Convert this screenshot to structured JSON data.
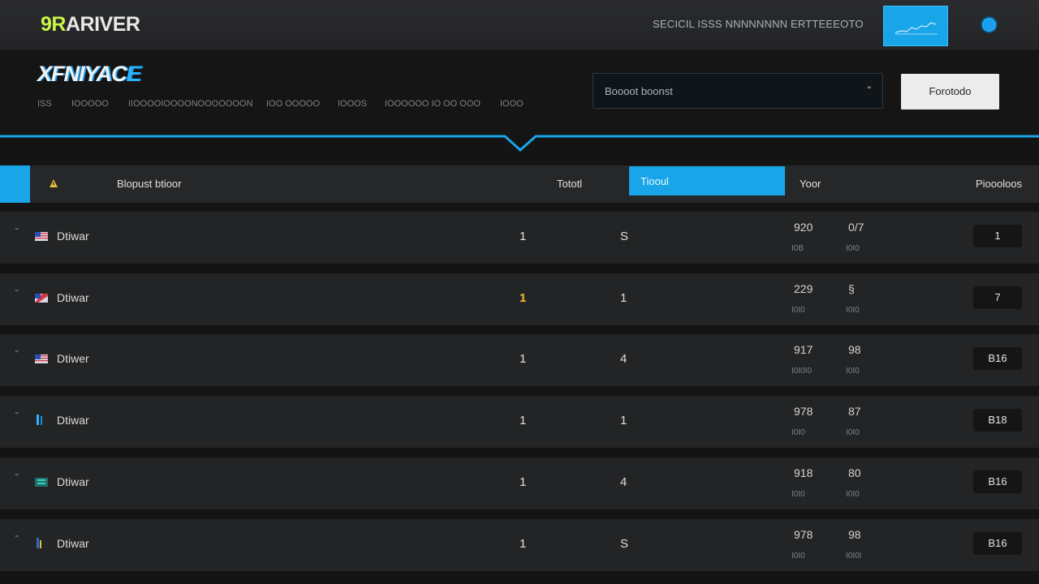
{
  "topbar": {
    "brand_prefix": "9R",
    "brand_rest": "ARIVER",
    "status_text": "SECICIL ISSS NNNNNNNN ERTTEEEOTO",
    "chart_icon": "chart-icon"
  },
  "header": {
    "logo_main": "XFNIYAC",
    "logo_accent": "E",
    "nav": [
      "ISS",
      "IOOOOO",
      "IIOOOOIOOOONOOOOOOON",
      "IOO OOOOO",
      "IOOOS",
      "IOOOOOO IO OO OOO",
      "IOOO"
    ],
    "search": {
      "label": "Boooot boonst",
      "clear": "\""
    },
    "action_label": "Forotodo"
  },
  "table": {
    "headers": {
      "name": "Blopust btioor",
      "total": "Tototl",
      "active": "Tiooul",
      "year": "Yoor",
      "points": "Pioooloos"
    },
    "rows": [
      {
        "handle": "\"",
        "name": "Dtiwar",
        "c1": "1",
        "c1_highlight": false,
        "c2": "S",
        "s1": "920",
        "s2": "0/7",
        "s3": "I0B",
        "s4": "I0I0",
        "points": "1",
        "flag": "us"
      },
      {
        "handle": "\"",
        "name": "Dtiwar",
        "c1": "1",
        "c1_highlight": true,
        "c2": "1",
        "s1": "229",
        "s2": "§",
        "s3": "I0I0",
        "s4": "I0I0",
        "points": "7",
        "flag": "us-diag"
      },
      {
        "handle": "\"",
        "name": "Dtiwer",
        "c1": "1",
        "c1_highlight": false,
        "c2": "4",
        "s1": "917",
        "s2": "98",
        "s3": "I0I0I0",
        "s4": "I0I0",
        "points": "B16",
        "flag": "us"
      },
      {
        "handle": "\"",
        "name": "Dtiwar",
        "c1": "1",
        "c1_highlight": false,
        "c2": "1",
        "s1": "978",
        "s2": "87",
        "s3": "I0I0",
        "s4": "I0I0",
        "points": "B18",
        "flag": "bar"
      },
      {
        "handle": "\"",
        "name": "Dtiwar",
        "c1": "1",
        "c1_highlight": false,
        "c2": "4",
        "s1": "918",
        "s2": "80",
        "s3": "I0I0",
        "s4": "I0I0",
        "points": "B16",
        "flag": "teal"
      },
      {
        "handle": "\"",
        "name": "Dtiwar",
        "c1": "1",
        "c1_highlight": false,
        "c2": "S",
        "s1": "978",
        "s2": "98",
        "s3": "I0I0",
        "s4": "I0I0I",
        "points": "B16",
        "flag": "bar2"
      }
    ]
  },
  "colors": {
    "accent": "#19a6e8",
    "brand_green": "#c9f24a",
    "highlight": "#f2c230"
  }
}
